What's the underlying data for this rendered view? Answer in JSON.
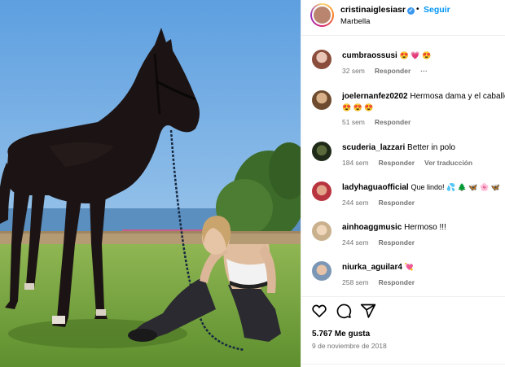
{
  "header": {
    "username": "cristinaiglesiasr",
    "separator": "•",
    "follow_label": "Seguir",
    "location": "Marbella"
  },
  "comments": [
    {
      "user": "cumbraossusi",
      "text": "😍 💗 😍",
      "time": "32 sem",
      "reply": "Responder",
      "extra": "···"
    },
    {
      "user": "joelernanfez0202",
      "text": "Hermosa dama y el caballo",
      "text2": "😍 😍 😍",
      "time": "51 sem",
      "reply": "Responder"
    },
    {
      "user": "scuderia_lazzari",
      "text": "Better in polo",
      "time": "184 sem",
      "reply": "Responder",
      "extra": "Ver traducción"
    },
    {
      "user": "ladyhaguaofficial",
      "text": "Que lindo! 💦 🌲 🦋 🌸 🦋",
      "time": "244 sem",
      "reply": "Responder"
    },
    {
      "user": "ainhoaggmusic",
      "text": "Hermoso !!!",
      "time": "244 sem",
      "reply": "Responder"
    },
    {
      "user": "niurka_aguilar4",
      "text": "💘",
      "time": "258 sem",
      "reply": "Responder"
    }
  ],
  "footer": {
    "likes": "5.767 Me gusta",
    "date": "9 de noviembre de 2018"
  },
  "icons": {
    "like": "heart-icon",
    "comment": "comment-icon",
    "share": "send-icon",
    "verified": "verified-badge-icon"
  },
  "colors": {
    "accent": "#0095f6",
    "verified": "#3897f0",
    "muted": "#737373",
    "border": "#efefef"
  }
}
